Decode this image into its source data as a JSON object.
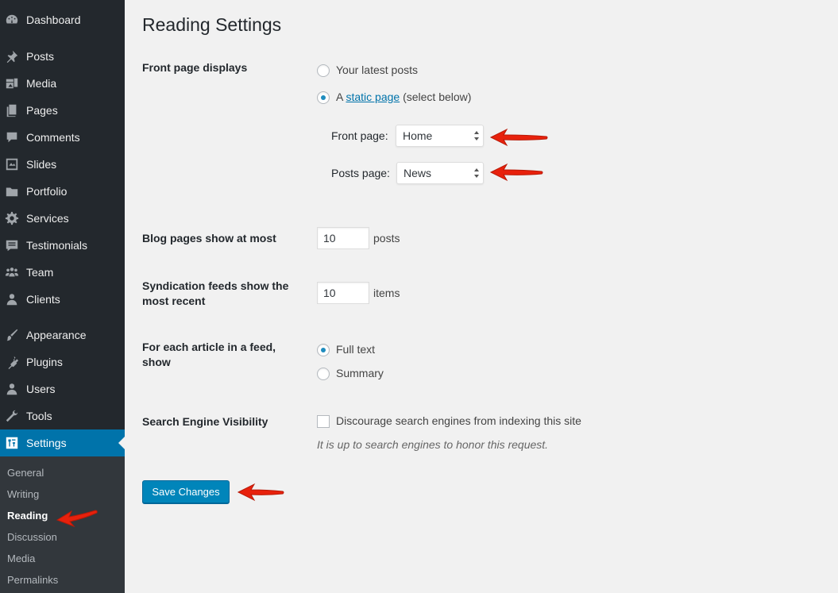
{
  "sidebar": {
    "items": [
      {
        "label": "Dashboard",
        "icon": "dashboard-icon"
      },
      {
        "label": "Posts",
        "icon": "pin-icon"
      },
      {
        "label": "Media",
        "icon": "media-icon"
      },
      {
        "label": "Pages",
        "icon": "pages-icon"
      },
      {
        "label": "Comments",
        "icon": "comment-icon"
      },
      {
        "label": "Slides",
        "icon": "slides-icon"
      },
      {
        "label": "Portfolio",
        "icon": "folder-icon"
      },
      {
        "label": "Services",
        "icon": "gear-icon"
      },
      {
        "label": "Testimonials",
        "icon": "testimonial-icon"
      },
      {
        "label": "Team",
        "icon": "team-icon"
      },
      {
        "label": "Clients",
        "icon": "user-icon"
      },
      {
        "label": "Appearance",
        "icon": "brush-icon"
      },
      {
        "label": "Plugins",
        "icon": "plugin-icon"
      },
      {
        "label": "Users",
        "icon": "users-icon"
      },
      {
        "label": "Tools",
        "icon": "wrench-icon"
      },
      {
        "label": "Settings",
        "icon": "settings-icon"
      }
    ],
    "submenu": [
      "General",
      "Writing",
      "Reading",
      "Discussion",
      "Media",
      "Permalinks"
    ]
  },
  "page": {
    "title": "Reading Settings",
    "front_page_displays": {
      "label": "Front page displays",
      "option_latest": "Your latest posts",
      "option_static_prefix": "A",
      "option_static_link": "static page",
      "option_static_suffix": "(select below)",
      "front_page_label": "Front page:",
      "front_page_value": "Home",
      "posts_page_label": "Posts page:",
      "posts_page_value": "News"
    },
    "blog_pages": {
      "label": "Blog pages show at most",
      "value": "10",
      "unit": "posts"
    },
    "syndication": {
      "label_line1": "Syndication feeds show the",
      "label_line2": "most recent",
      "value": "10",
      "unit": "items"
    },
    "feed_article": {
      "label_line1": "For each article in a feed,",
      "label_line2": "show",
      "option_full": "Full text",
      "option_summary": "Summary"
    },
    "search_engine": {
      "label": "Search Engine Visibility",
      "checkbox_label": "Discourage search engines from indexing this site",
      "description": "It is up to search engines to honor this request."
    },
    "save_button": "Save Changes"
  },
  "colors": {
    "sidebar_bg": "#23282d",
    "submenu_bg": "#32373c",
    "current_item": "#0073aa",
    "annotation_arrow": "#e8210c",
    "button": "#0085ba"
  }
}
